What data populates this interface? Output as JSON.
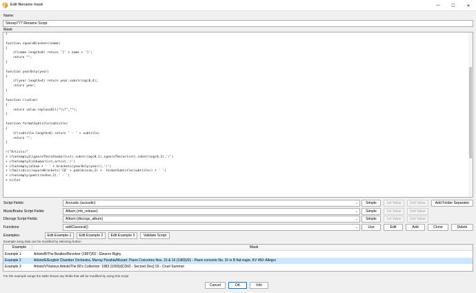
{
  "window": {
    "title": "Edit filename mask",
    "minimize": "—",
    "maximize": "☐",
    "close": "✕"
  },
  "name_label": "Name:",
  "name_value": "Stevep777 Rename Script",
  "mask_label": "Mask:",
  "mask_code": "}\n\nfunction squareBrackets(name)\n{\n    if(name.length>0) return '[' + name + ']';\n    return \"\";\n}\n\nfunction yearOnly(year)\n{\n    if(year.length>4) return year.substring(0,4);\n    return year;\n}\n\nfunction r(value)\n{\n    return value.replaceAll(\"\\\\?\",\"\");\n}\n\nfunction formatSubtitle(subtitle)\n{\n    if(subtitle.length>0) return ' - ' + subtitle;\n    return \"\";\n}\n\nr(\"Artists/\"\n+ ifnotempty2(ignoreThe(albumartist).substring(0,1),ignoreThe(artist).substring(0,1),'/')\n+ ifnotempty2(albumartist,artist,'/')\n+ ifnotempty(album + ' ' + brackets(yearOnly(year)),'/')\n+ ifmultidisc(squareBrackets('CD' + pad(discno,2) +  formatSubtitle(subtitle)) + ' ')\n+ ifnotempty(pad(trackno,2),' - ')\n+ title)",
  "fields": [
    {
      "label": "Script Fields:",
      "value": "Acoustic (acoustic)",
      "buttons": [
        "Simple",
        "1st Value",
        "2nd Value",
        "Add Folder Separator"
      ]
    },
    {
      "label": "MusicBrainz Script Fields:",
      "value": "Album (mb_release)",
      "buttons": [
        "Simple",
        "1st Value",
        "2nd Value"
      ]
    },
    {
      "label": "Discogs Script Fields:",
      "value": "Album (discogs_album)",
      "buttons": [
        "Simple",
        "1st Value",
        "2nd Value"
      ]
    },
    {
      "label": "Functions",
      "value": "addClassical()",
      "buttons": [
        "Use",
        "Edit",
        "Add",
        "Clone",
        "Delete"
      ]
    }
  ],
  "examples_label": "Examples:",
  "example_buttons": [
    "Edit Example 1",
    "Edit Example 2",
    "Edit Example 3",
    "Validate Script"
  ],
  "example_hint": "Example song data can be modified by selecting button",
  "table": {
    "col_example": "Example",
    "col_mask": "Mask",
    "rows": [
      {
        "example": "Example 1",
        "mask": "Artists/B/The Beatles/Revolver (1987)/02 - Eleanor Rigby"
      },
      {
        "example": "Example 2",
        "mask": "Artists/E/English Chamber Orchestra, Murray Perahia/Mozart: Piano Concertos Nos. 15 & 16 (1983)/01 - Piano concerto No. 15 in B flat major, KV 450: Allegro"
      },
      {
        "example": "Example 3",
        "mask": "Artists/V/Various Artists/The 80's Collection: 1983 (1993)/[CD02 - Second Disc] 03 - Cruel Summer"
      }
    ]
  },
  "footer_note": "For the example songs the table shows any fields that will be modified by using this script",
  "bottom_buttons": {
    "cancel": "Cancel",
    "ok": "OK",
    "info": "Info"
  },
  "colors": {
    "selected_row": "#cce8ff",
    "accent": "#0078d7"
  }
}
